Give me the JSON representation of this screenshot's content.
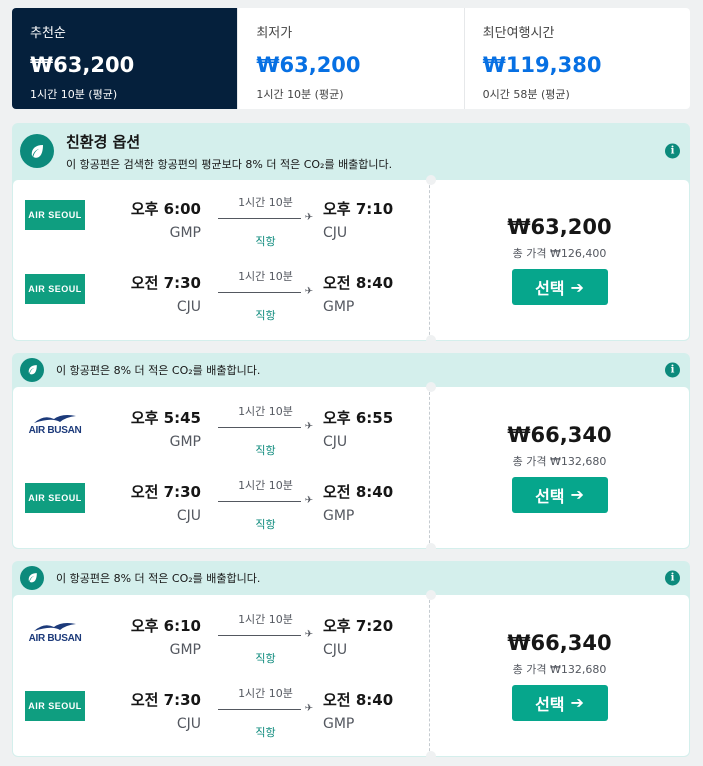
{
  "sort": {
    "tabs": [
      {
        "label": "추천순",
        "price": "₩63,200",
        "sub": "1시간 10분 (평균)"
      },
      {
        "label": "최저가",
        "price": "₩63,200",
        "sub": "1시간 10분 (평균)"
      },
      {
        "label": "최단여행시간",
        "price": "₩119,380",
        "sub": "0시간 58분 (평균)"
      }
    ]
  },
  "eco": {
    "title": "친환경 옵션",
    "text": "이 항공편은 검색한 항공편의 평균보다 8% 더 적은 CO₂를 배출합니다.",
    "short_text": "이 항공편은 8% 더 적은 CO₂를 배출합니다."
  },
  "icons": {
    "info": "i",
    "arrow": "➔",
    "plane": "✈"
  },
  "results": [
    {
      "legs": [
        {
          "airline": "AIR SEOUL",
          "dep_time": "오후 6:00",
          "dep_code": "GMP",
          "duration": "1시간 10분",
          "stops": "직항",
          "arr_time": "오후 7:10",
          "arr_code": "CJU"
        },
        {
          "airline": "AIR SEOUL",
          "dep_time": "오전 7:30",
          "dep_code": "CJU",
          "duration": "1시간 10분",
          "stops": "직항",
          "arr_time": "오전 8:40",
          "arr_code": "GMP"
        }
      ],
      "price": "₩63,200",
      "total": "총 가격 ₩126,400",
      "select_label": "선택"
    },
    {
      "legs": [
        {
          "airline": "AIR BUSAN",
          "dep_time": "오후 5:45",
          "dep_code": "GMP",
          "duration": "1시간 10분",
          "stops": "직항",
          "arr_time": "오후 6:55",
          "arr_code": "CJU"
        },
        {
          "airline": "AIR SEOUL",
          "dep_time": "오전 7:30",
          "dep_code": "CJU",
          "duration": "1시간 10분",
          "stops": "직항",
          "arr_time": "오전 8:40",
          "arr_code": "GMP"
        }
      ],
      "price": "₩66,340",
      "total": "총 가격 ₩132,680",
      "select_label": "선택"
    },
    {
      "legs": [
        {
          "airline": "AIR BUSAN",
          "dep_time": "오후 6:10",
          "dep_code": "GMP",
          "duration": "1시간 10분",
          "stops": "직항",
          "arr_time": "오후 7:20",
          "arr_code": "CJU"
        },
        {
          "airline": "AIR SEOUL",
          "dep_time": "오전 7:30",
          "dep_code": "CJU",
          "duration": "1시간 10분",
          "stops": "직항",
          "arr_time": "오전 8:40",
          "arr_code": "GMP"
        }
      ],
      "price": "₩66,340",
      "total": "총 가격 ₩132,680",
      "select_label": "선택"
    }
  ]
}
